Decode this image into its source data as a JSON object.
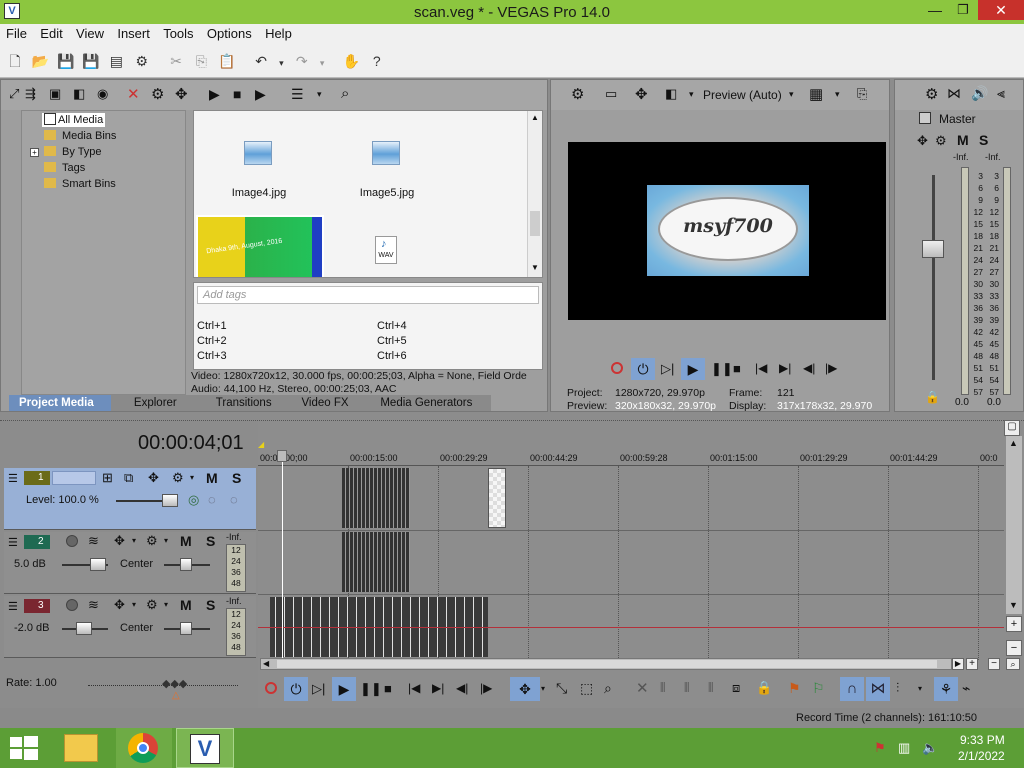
{
  "window": {
    "title": "scan.veg * - VEGAS Pro 14.0"
  },
  "menu": [
    "File",
    "Edit",
    "View",
    "Insert",
    "Tools",
    "Options",
    "Help"
  ],
  "media": {
    "tree": [
      "All Media",
      "Media Bins",
      "By Type",
      "Tags",
      "Smart Bins"
    ],
    "files": [
      "Image4.jpg",
      "Image5.jpg"
    ],
    "wav_label": "WAV",
    "tags_placeholder": "Add tags",
    "shortcuts_left": [
      "Ctrl+1",
      "Ctrl+2",
      "Ctrl+3"
    ],
    "shortcuts_right": [
      "Ctrl+4",
      "Ctrl+5",
      "Ctrl+6"
    ],
    "info_video": "Video: 1280x720x12, 30.000 fps, 00:00:25;03, Alpha = None, Field Orde",
    "info_audio": "Audio: 44,100 Hz, Stereo, 00:00:25;03, AAC",
    "thumb_text": "Dhaka 9th, August, 2016",
    "tabs": [
      "Project Media",
      "Explorer",
      "Transitions",
      "Video FX",
      "Media Generators"
    ]
  },
  "preview": {
    "mode_label": "Preview (Auto)",
    "logo_text": "msyf700",
    "project_label": "Project:",
    "project_value": "1280x720, 29.970p",
    "preview_label": "Preview:",
    "preview_value": "320x180x32, 29.970p",
    "frame_label": "Frame:",
    "frame_value": "121",
    "display_label": "Display:",
    "display_value": "317x178x32, 29.970"
  },
  "master": {
    "label": "Master",
    "inf_left": "-Inf.",
    "inf_right": "-Inf.",
    "ticks": [
      "3",
      "6",
      "9",
      "12",
      "15",
      "18",
      "21",
      "24",
      "27",
      "30",
      "33",
      "36",
      "39",
      "42",
      "45",
      "48",
      "51",
      "54",
      "57"
    ],
    "bottom_left": "0.0",
    "bottom_right": "0.0"
  },
  "timeline": {
    "timecode": "00:00:04;01",
    "ruler": [
      "00:00:00;00",
      "00:00:15:00",
      "00:00:29:29",
      "00:00:44:29",
      "00:00:59:28",
      "00:01:15:00",
      "00:01:29:29",
      "00:01:44:29",
      "00:0"
    ],
    "track1": {
      "num": "1",
      "level": "Level: 100.0 %"
    },
    "track2": {
      "num": "2",
      "db": "5.0 dB",
      "pan": "Center",
      "inf": "-Inf.",
      "meter": [
        "12",
        "24",
        "36",
        "48"
      ]
    },
    "track3": {
      "num": "3",
      "db": "-2.0 dB",
      "pan": "Center",
      "inf": "-Inf.",
      "meter": [
        "12",
        "24",
        "36",
        "48"
      ]
    },
    "rate": "Rate: 1.00",
    "record_time": "Record Time (2 channels): 161:10:50"
  },
  "taskbar": {
    "time": "9:33 PM",
    "date": "2/1/2022"
  },
  "colors": {
    "titlebar": "#8cc63f",
    "taskbar": "#5c9e36",
    "tab_active": "#6d8ebd",
    "track_selected": "#98b0d6"
  }
}
